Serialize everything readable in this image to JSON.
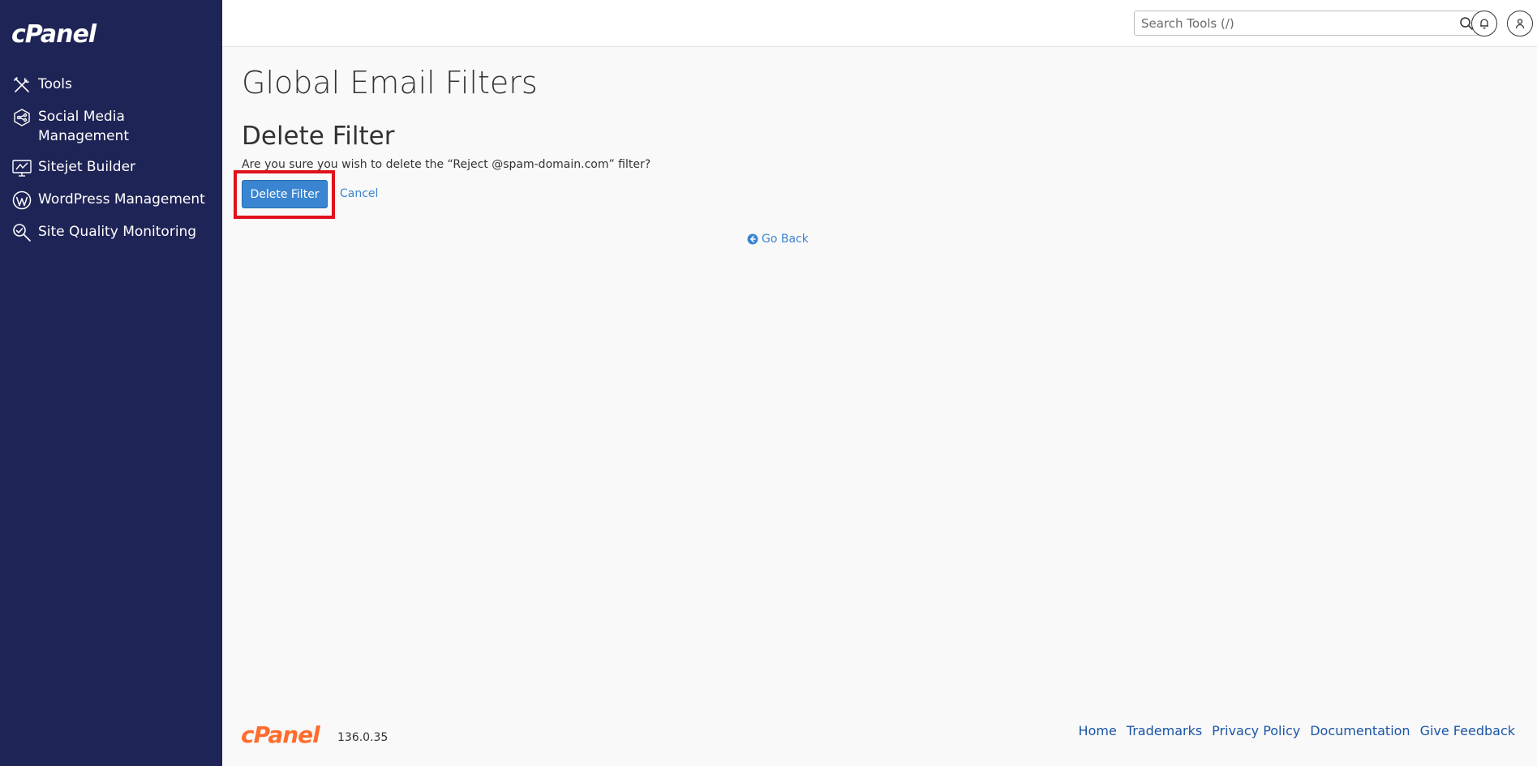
{
  "sidebar": {
    "logo": "cPanel",
    "items": [
      {
        "label": "Tools",
        "icon": "tools-icon"
      },
      {
        "label": "Social Media Management",
        "icon": "social-media-icon"
      },
      {
        "label": "Sitejet Builder",
        "icon": "sitejet-icon"
      },
      {
        "label": "WordPress Management",
        "icon": "wordpress-icon"
      },
      {
        "label": "Site Quality Monitoring",
        "icon": "site-quality-icon"
      }
    ]
  },
  "header": {
    "search_placeholder": "Search Tools (/)"
  },
  "main": {
    "page_title": "Global Email Filters",
    "section_title": "Delete Filter",
    "confirm_text": "Are you sure you wish to delete the “Reject @spam-domain.com” filter?",
    "delete_label": "Delete Filter",
    "cancel_label": "Cancel",
    "go_back_label": "Go Back"
  },
  "footer": {
    "logo": "cPanel",
    "version": "136.0.35",
    "links": [
      "Home",
      "Trademarks",
      "Privacy Policy",
      "Documentation",
      "Give Feedback"
    ]
  },
  "colors": {
    "sidebar_bg": "#1f2456",
    "primary_button": "#3a85d1",
    "highlight": "#e0111c",
    "footer_logo": "#ff6c2c"
  }
}
